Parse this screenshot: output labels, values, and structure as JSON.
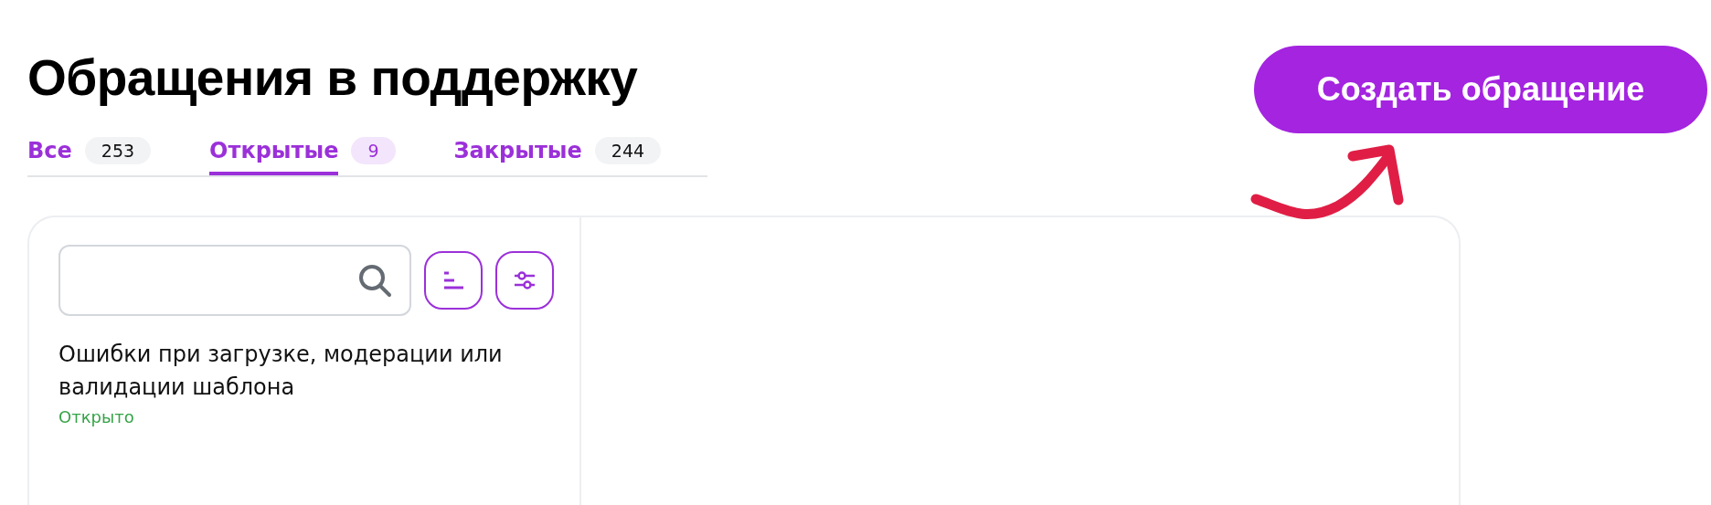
{
  "header": {
    "title": "Обращения в поддержку",
    "create_button": "Создать обращение"
  },
  "tabs": [
    {
      "label": "Все",
      "count": "253",
      "selected": false
    },
    {
      "label": "Открытые",
      "count": "9",
      "selected": true
    },
    {
      "label": "Закрытые",
      "count": "244",
      "selected": false
    }
  ],
  "tickets": [
    {
      "title": "Ошибки при загрузке, модерации или валидации шаблона",
      "status": "Открыто",
      "kind": "open"
    }
  ]
}
